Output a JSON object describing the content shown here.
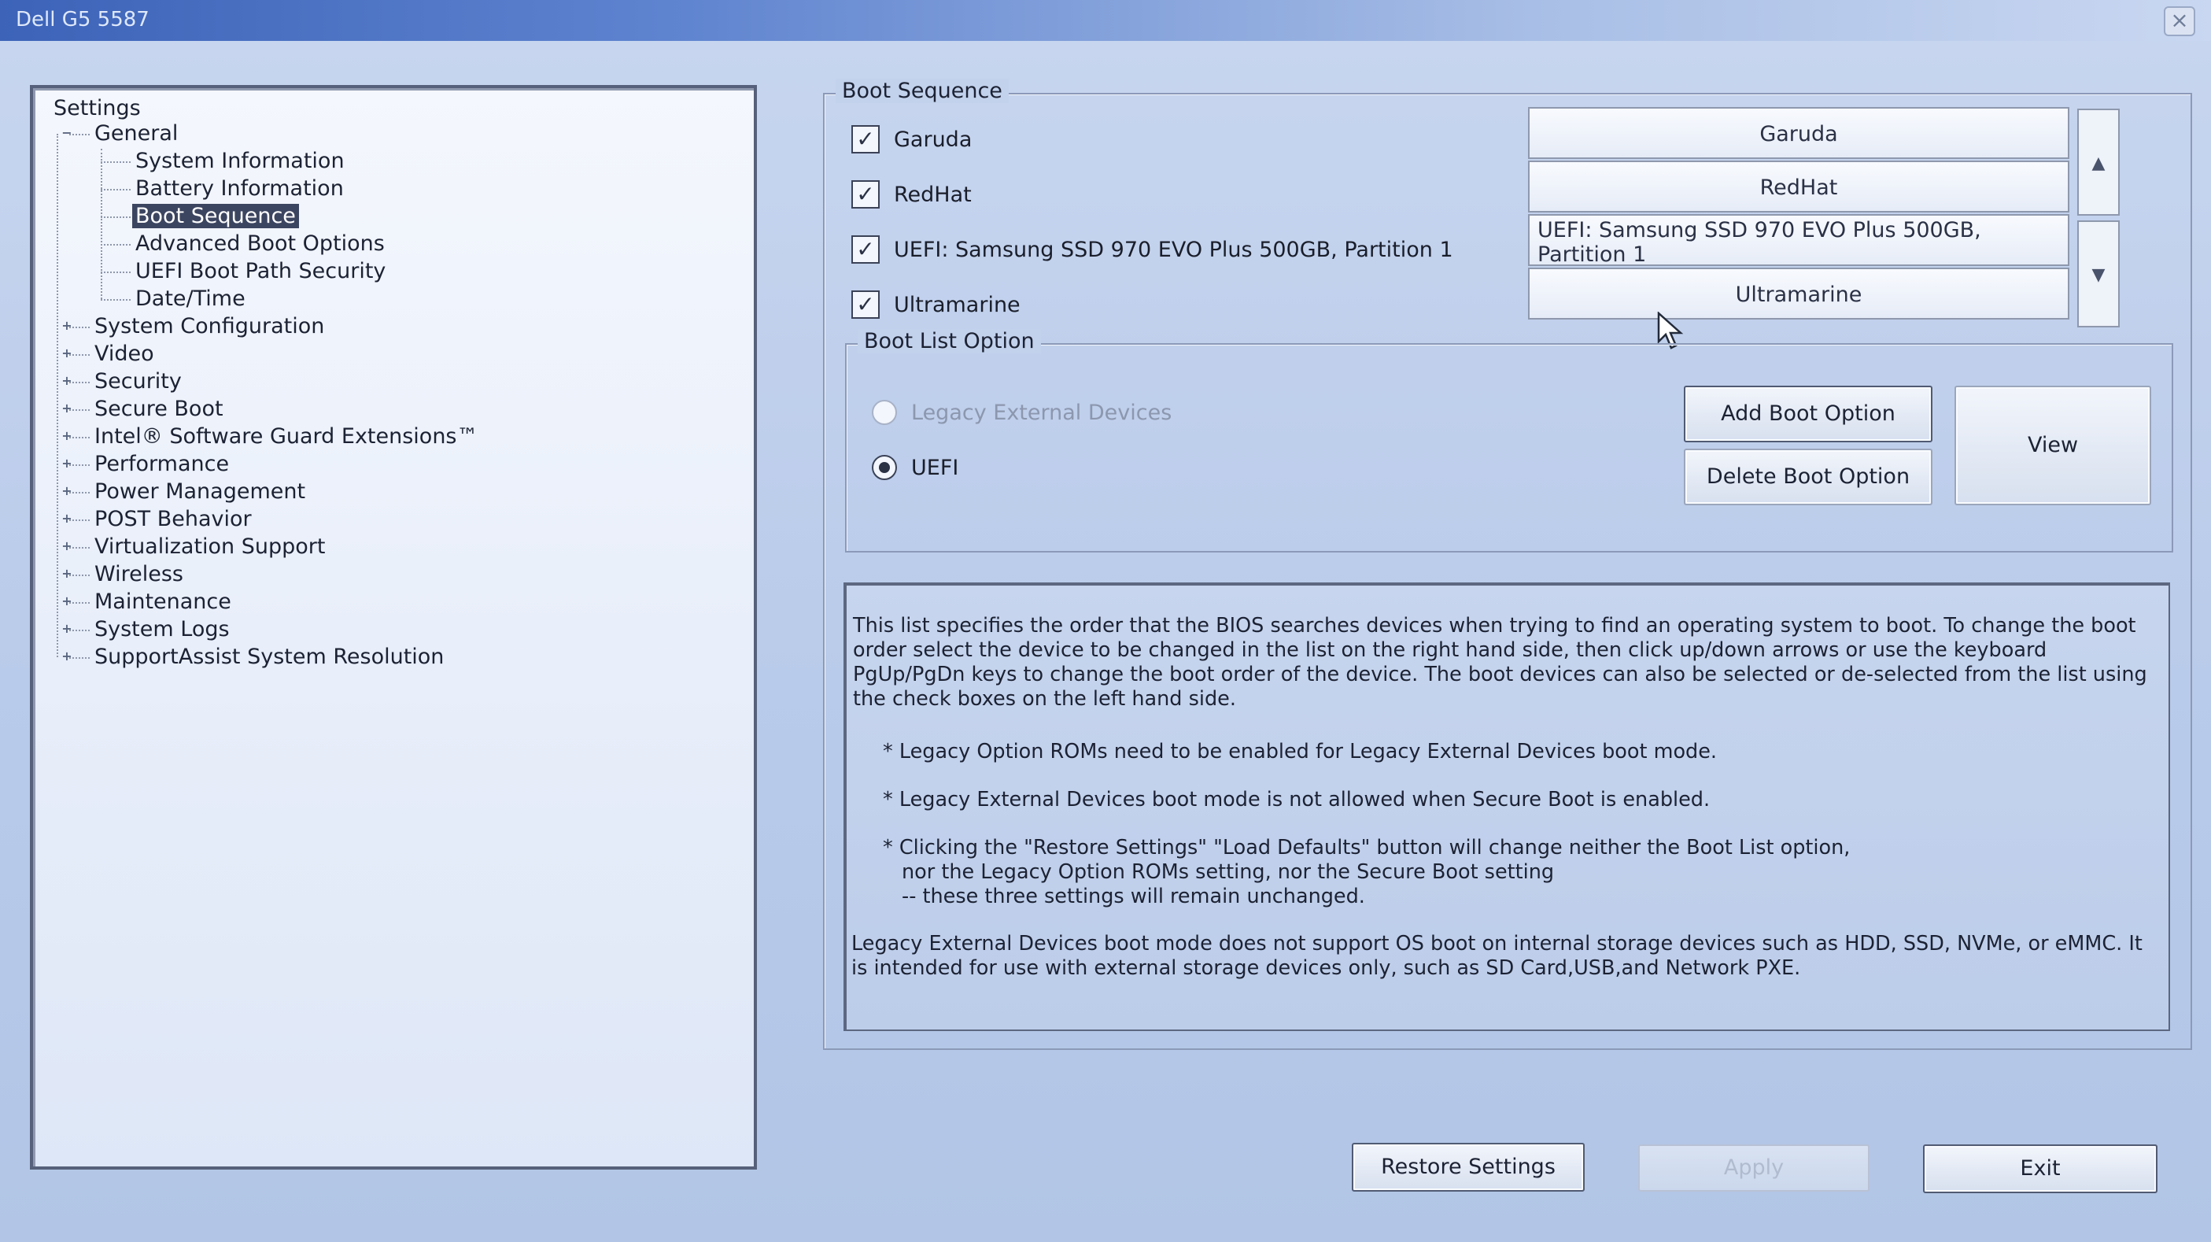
{
  "window": {
    "title": "Dell G5 5587",
    "close_glyph": "×"
  },
  "tree": {
    "root": "Settings",
    "expand_glyphs": {
      "collapsed": "+",
      "expanded": "−"
    },
    "items": [
      {
        "label": "General",
        "level": 1,
        "expanded": true
      },
      {
        "label": "System Information",
        "level": 2
      },
      {
        "label": "Battery Information",
        "level": 2
      },
      {
        "label": "Boot Sequence",
        "level": 2,
        "selected": true
      },
      {
        "label": "Advanced Boot Options",
        "level": 2
      },
      {
        "label": "UEFI Boot Path Security",
        "level": 2
      },
      {
        "label": "Date/Time",
        "level": 2
      },
      {
        "label": "System Configuration",
        "level": 1
      },
      {
        "label": "Video",
        "level": 1
      },
      {
        "label": "Security",
        "level": 1
      },
      {
        "label": "Secure Boot",
        "level": 1
      },
      {
        "label": "Intel® Software Guard Extensions™",
        "level": 1
      },
      {
        "label": "Performance",
        "level": 1
      },
      {
        "label": "Power Management",
        "level": 1
      },
      {
        "label": "POST Behavior",
        "level": 1
      },
      {
        "label": "Virtualization Support",
        "level": 1
      },
      {
        "label": "Wireless",
        "level": 1
      },
      {
        "label": "Maintenance",
        "level": 1
      },
      {
        "label": "System Logs",
        "level": 1
      },
      {
        "label": "SupportAssist System Resolution",
        "level": 1
      }
    ]
  },
  "boot_sequence": {
    "title": "Boot Sequence",
    "check_glyph": "✓",
    "devices": [
      {
        "label": "Garuda",
        "checked": true
      },
      {
        "label": "RedHat",
        "checked": true
      },
      {
        "label": "UEFI: Samsung SSD 970 EVO Plus 500GB, Partition 1",
        "checked": true
      },
      {
        "label": "Ultramarine",
        "checked": true
      }
    ],
    "order_list": [
      "Garuda",
      "RedHat",
      "UEFI: Samsung SSD 970 EVO Plus 500GB, Partition 1",
      "Ultramarine"
    ],
    "move_up_glyph": "▲",
    "move_down_glyph": "▼"
  },
  "boot_list_option": {
    "title": "Boot List Option",
    "options": [
      {
        "label": "Legacy External Devices",
        "selected": false,
        "enabled": false
      },
      {
        "label": "UEFI",
        "selected": true,
        "enabled": true
      }
    ],
    "add_button": "Add Boot Option",
    "delete_button": "Delete Boot Option",
    "view_button": "View"
  },
  "description": {
    "intro": "This list specifies the order that the BIOS searches devices when trying to find an operating system to boot. To change the boot order select the device to be changed in the list on the right hand side, then click up/down arrows or use the keyboard PgUp/PgDn keys to change the boot order of the device. The boot devices can also be selected or de-selected from the list using the check boxes on the left hand side.",
    "note1": "* Legacy Option ROMs need to be enabled for Legacy External Devices boot mode.",
    "note2": "* Legacy External Devices boot mode is not allowed when Secure Boot is enabled.",
    "note3_line1": "* Clicking the \"Restore Settings\" \"Load Defaults\" button will change neither the Boot List option,",
    "note3_line2": "nor the Legacy Option ROMs setting, nor the Secure Boot setting",
    "note3_line3": "-- these three settings will remain unchanged.",
    "footer": "Legacy External Devices boot mode does not support OS boot on internal storage devices such as HDD, SSD, NVMe, or eMMC. It is intended for use with external storage devices only, such as SD Card,USB,and Network PXE."
  },
  "footer_buttons": {
    "restore": "Restore Settings",
    "apply": "Apply",
    "exit": "Exit"
  }
}
